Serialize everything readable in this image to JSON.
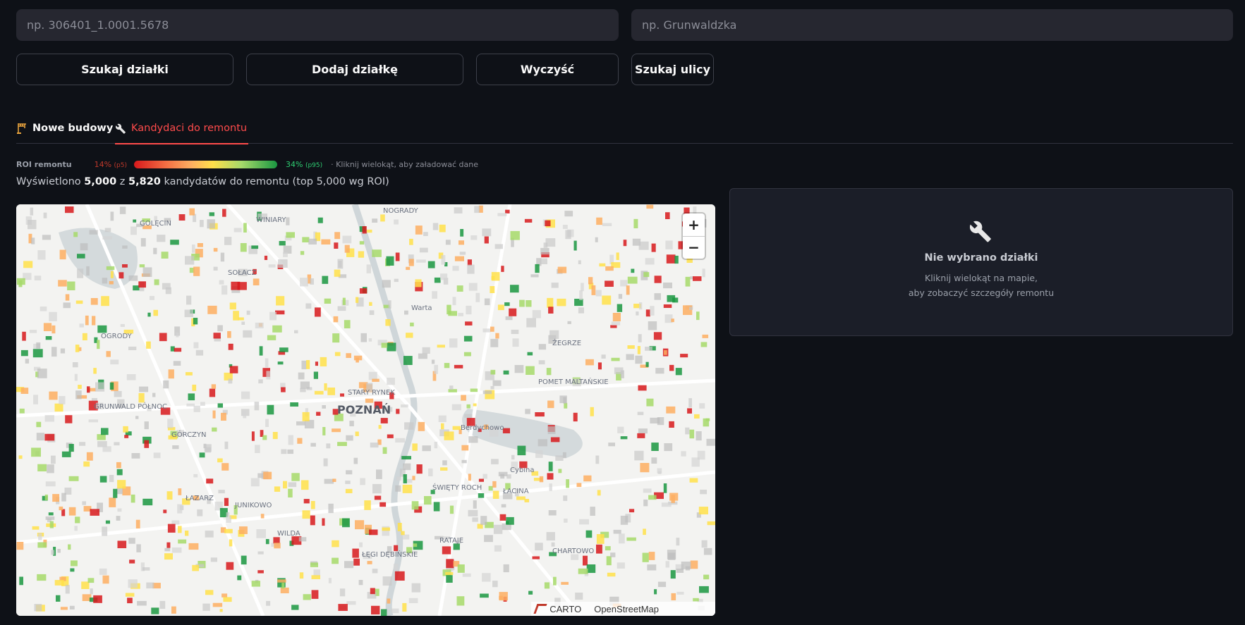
{
  "search": {
    "parcel_placeholder": "np. 306401_1.0001.5678",
    "street_placeholder": "np. Grunwaldzka"
  },
  "buttons": {
    "search_parcel": "Szukaj działki",
    "add_parcel": "Dodaj działkę",
    "clear": "Wyczyść",
    "search_street": "Szukaj ulicy"
  },
  "tabs": [
    {
      "label": "Nowe budowy",
      "icon": "crane-icon",
      "active": false
    },
    {
      "label": "Kandydaci do remontu",
      "icon": "wrench-icon",
      "active": true
    }
  ],
  "legend": {
    "title": "ROI remontu",
    "low_value": "14%",
    "low_pct": "(p5)",
    "high_value": "34%",
    "high_pct": "(p95)",
    "hint": "· Kliknij wielokąt, aby załadować dane",
    "colors": [
      "#d7191c",
      "#fdae61",
      "#ffe04a",
      "#a6d96a",
      "#1a9641"
    ]
  },
  "summary": {
    "prefix": "Wyświetlono",
    "shown": "5,000",
    "of": "z",
    "total": "5,820",
    "suffix": "kandydatów do remontu (top 5,000 wg ROI)"
  },
  "map": {
    "city_label": "POZNAŃ",
    "labels": [
      "NOGRADY",
      "WINIARY",
      "SOŁACZ",
      "OGRODY",
      "GRUNWALD PÓŁNOC",
      "GÓRCZYN",
      "ŁAZARZ",
      "JUNIKOWO",
      "WILDA",
      "ŁĘGI DĘBIŃSKIE",
      "ŚWIĘTY ROCH",
      "RATAJE",
      "CHARTOWO",
      "ŻEGRZE",
      "POMET MALTAŃSKIE",
      "Berdychowo",
      "STARY RYNEK",
      "ŁACINA",
      "Warta",
      "Cybina",
      "GOLĘCIN"
    ],
    "attribution": [
      "CARTO",
      "OpenStreetMap"
    ],
    "zoom_in": "+",
    "zoom_out": "−"
  },
  "panel": {
    "icon": "wrench-icon",
    "title": "Nie wybrano działki",
    "line1": "Kliknij wielokąt na mapie,",
    "line2": "aby zobaczyć szczegóły remontu"
  }
}
